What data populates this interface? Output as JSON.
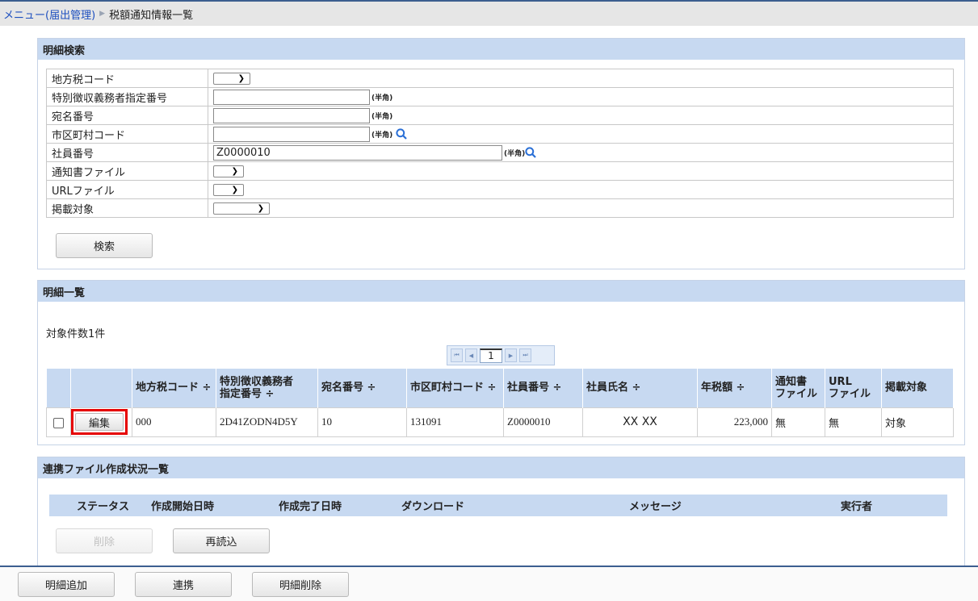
{
  "breadcrumb": {
    "menu": "メニュー(届出管理)",
    "current": "税額通知情報一覧"
  },
  "search": {
    "title": "明細検索",
    "fields": {
      "local_tax_code": "地方税コード",
      "special_collector_no": "特別徴収義務者指定番号",
      "addressee_no": "宛名番号",
      "municipality_code": "市区町村コード",
      "employee_no": "社員番号",
      "notice_file": "通知書ファイル",
      "url_file": "URLファイル",
      "publish_target": "掲載対象"
    },
    "employee_no_value": "Z0000010",
    "half_width_hint": "(半角)",
    "search_button": "検索"
  },
  "list": {
    "title": "明細一覧",
    "count_text": "対象件数1件",
    "page": "1",
    "headers": {
      "local_tax_code": "地方税コード ÷",
      "special_collector_no_1": "特別徴収義務者",
      "special_collector_no_2": "指定番号 ÷",
      "addressee_no": "宛名番号 ÷",
      "municipality_code": "市区町村コード ÷",
      "employee_no": "社員番号 ÷",
      "employee_name": "社員氏名 ÷",
      "annual_tax": "年税額 ÷",
      "notice_file_1": "通知書",
      "notice_file_2": "ファイル",
      "url_file_1": "URL",
      "url_file_2": "ファイル",
      "publish_target": "掲載対象"
    },
    "row": {
      "edit_button": "編集",
      "local_tax_code": "000",
      "special_collector_no": "2D41ZODN4D5Y",
      "addressee_no": "10",
      "municipality_code": "131091",
      "employee_no": "Z0000010",
      "employee_name": "XX XX",
      "annual_tax": "223,000",
      "notice_file": "無",
      "url_file": "無",
      "publish_target": "対象"
    }
  },
  "sync": {
    "title": "連携ファイル作成状況一覧",
    "headers": {
      "status": "ステータス",
      "start": "作成開始日時",
      "end": "作成完了日時",
      "download": "ダウンロード",
      "message": "メッセージ",
      "executor": "実行者"
    },
    "delete_button": "削除",
    "reload_button": "再読込"
  },
  "footer": {
    "add_button": "明細追加",
    "link_button": "連携",
    "delete_button": "明細削除"
  },
  "colors": {
    "accent": "#1d4fbf",
    "header_bg": "#c7d9f1",
    "highlight": "#e60000"
  }
}
